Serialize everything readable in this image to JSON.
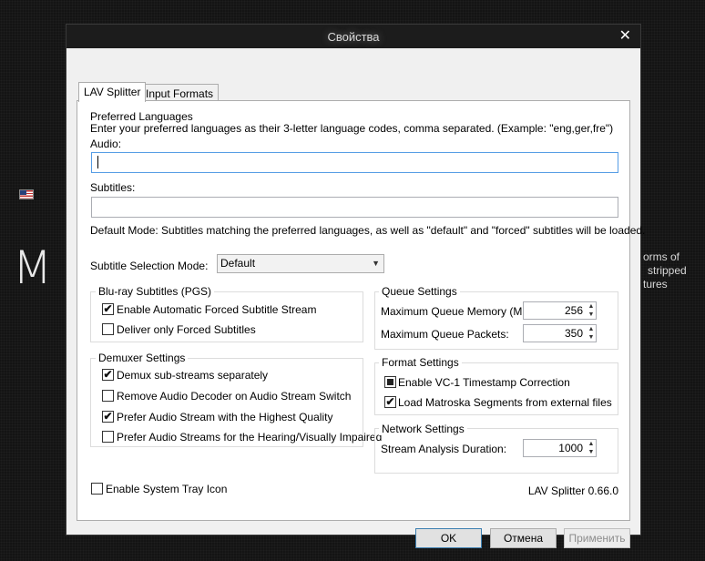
{
  "background": {
    "letter": "M",
    "text_lines": [
      "orms  of",
      "stripped",
      "tures"
    ]
  },
  "window": {
    "title": "Свойства",
    "close_glyph": "✕"
  },
  "tabs": [
    {
      "label": "LAV Splitter",
      "active": true
    },
    {
      "label": "Input Formats",
      "active": false
    }
  ],
  "languages": {
    "heading": "Preferred Languages",
    "description": "Enter your preferred languages as their 3-letter language codes, comma separated. (Example: \"eng,ger,fre\")",
    "audio_label": "Audio:",
    "audio_value": "",
    "subtitles_label": "Subtitles:",
    "subtitles_value": "",
    "default_mode_text": "Default Mode: Subtitles matching the preferred languages, as well as \"default\" and \"forced\" subtitles will be loaded."
  },
  "subtitle_mode": {
    "label": "Subtitle Selection Mode:",
    "selected": "Default"
  },
  "bluray": {
    "title": "Blu-ray Subtitles (PGS)",
    "options": [
      {
        "label": "Enable Automatic Forced Subtitle Stream",
        "checked": true
      },
      {
        "label": "Deliver only Forced Subtitles",
        "checked": false
      }
    ]
  },
  "demuxer": {
    "title": "Demuxer Settings",
    "options": [
      {
        "label": "Demux sub-streams separately",
        "checked": true
      },
      {
        "label": "Remove Audio Decoder on Audio Stream Switch",
        "checked": false
      },
      {
        "label": "Prefer Audio Stream with the Highest Quality",
        "checked": true
      },
      {
        "label": "Prefer Audio Streams for the Hearing/Visually Impaired",
        "checked": false
      }
    ]
  },
  "queue": {
    "title": "Queue Settings",
    "memory_label": "Maximum Queue Memory (MB):",
    "memory_value": "256",
    "packets_label": "Maximum Queue Packets:",
    "packets_value": "350"
  },
  "format": {
    "title": "Format Settings",
    "options": [
      {
        "label": "Enable VC-1 Timestamp Correction",
        "state": "indeterminate"
      },
      {
        "label": "Load Matroska Segments from external files",
        "checked": true
      }
    ]
  },
  "network": {
    "title": "Network Settings",
    "duration_label": "Stream Analysis Duration:",
    "duration_value": "1000"
  },
  "tray": {
    "label": "Enable System Tray Icon",
    "checked": false
  },
  "version": "LAV Splitter 0.66.0",
  "buttons": {
    "ok": "OK",
    "cancel": "Отмена",
    "apply": "Применить"
  },
  "glyphs": {
    "check": "✔",
    "dropdown": "▼",
    "spin_up": "▲",
    "spin_down": "▼"
  }
}
